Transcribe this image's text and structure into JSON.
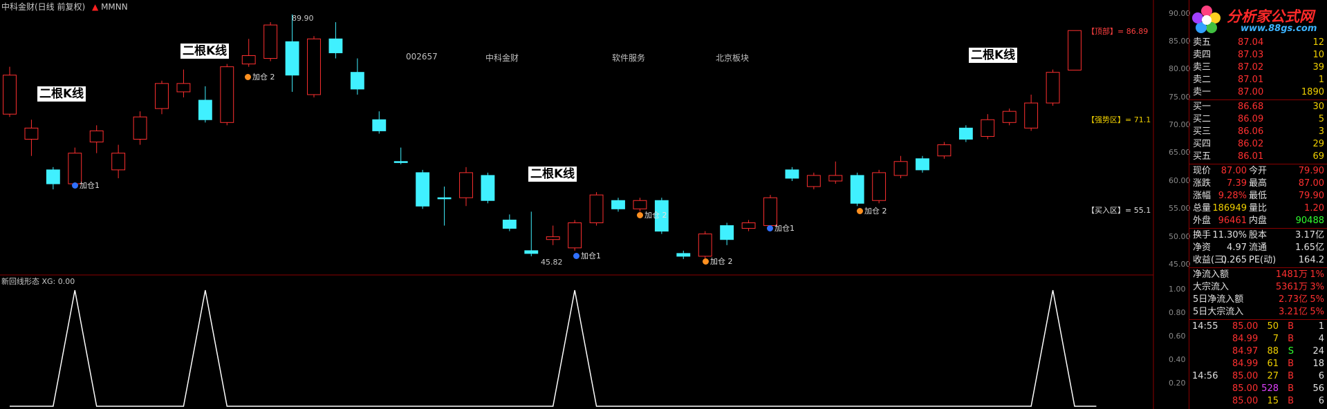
{
  "header": {
    "title": "中科金财(日线 前复权)",
    "indicator": "MMNN",
    "arrow_icon": "up-arrow-icon"
  },
  "info_bar": {
    "code": "002657",
    "name": "中科金财",
    "industry": "软件服务",
    "board": "北京板块",
    "code_color": "#f0d000",
    "name_color": "#ff3030",
    "industry_color": "#40d0ff",
    "board_color": "#e0e0e0"
  },
  "callouts": [
    "二根K线",
    "二根K线",
    "二根K线",
    "二根K线"
  ],
  "add_labels": [
    "加仓1",
    "加仓 2",
    "加仓1",
    "加仓 2",
    "加仓 2",
    "加仓1",
    "加仓 2"
  ],
  "high_label": "89.90",
  "low_label": "45.82",
  "zones": {
    "top": "【顶部】= 86.89",
    "strong": "【强势区】= 71.1",
    "buy": "【买入区】= 55.1"
  },
  "price_axis": [
    "90.00",
    "85.00",
    "80.00",
    "75.00",
    "70.00",
    "65.00",
    "60.00",
    "55.00",
    "50.00",
    "45.00"
  ],
  "indicator_panel": {
    "label": "新回线形态 XG: 0.00",
    "axis": [
      "1.00",
      "0.80",
      "0.60",
      "0.40",
      "0.20"
    ]
  },
  "logo": {
    "text": "分析家公式网",
    "url": "www.88gs.com",
    "icon": "flower-logo-icon"
  },
  "order_book": {
    "asks": [
      {
        "label": "卖五",
        "price": "87.04",
        "vol": "12"
      },
      {
        "label": "卖四",
        "price": "87.03",
        "vol": "10"
      },
      {
        "label": "卖三",
        "price": "87.02",
        "vol": "39"
      },
      {
        "label": "卖二",
        "price": "87.01",
        "vol": "1"
      },
      {
        "label": "卖一",
        "price": "87.00",
        "vol": "1890"
      }
    ],
    "bids": [
      {
        "label": "买一",
        "price": "86.68",
        "vol": "30"
      },
      {
        "label": "买二",
        "price": "86.09",
        "vol": "5"
      },
      {
        "label": "买三",
        "price": "86.06",
        "vol": "3"
      },
      {
        "label": "买四",
        "price": "86.02",
        "vol": "29"
      },
      {
        "label": "买五",
        "price": "86.01",
        "vol": "69"
      }
    ]
  },
  "stats": [
    {
      "l1": "现价",
      "v1": "87.00",
      "l2": "今开",
      "v2": "79.90",
      "c1": "#ff3030",
      "c2": "#ff3030"
    },
    {
      "l1": "涨跌",
      "v1": "7.39",
      "l2": "最高",
      "v2": "87.00",
      "c1": "#ff3030",
      "c2": "#ff3030"
    },
    {
      "l1": "涨幅",
      "v1": "9.28%",
      "l2": "最低",
      "v2": "79.90",
      "c1": "#ff3030",
      "c2": "#ff3030"
    },
    {
      "l1": "总量",
      "v1": "186949",
      "l2": "量比",
      "v2": "1.20",
      "c1": "#f0d000",
      "c2": "#ff3030"
    },
    {
      "l1": "外盘",
      "v1": "96461",
      "l2": "内盘",
      "v2": "90488",
      "c1": "#ff3030",
      "c2": "#30ff30"
    },
    {
      "l1": "换手",
      "v1": "11.30%",
      "l2": "股本",
      "v2": "3.17亿",
      "c1": "#e0e0e0",
      "c2": "#e0e0e0"
    },
    {
      "l1": "净资",
      "v1": "4.97",
      "l2": "流通",
      "v2": "1.65亿",
      "c1": "#e0e0e0",
      "c2": "#e0e0e0"
    },
    {
      "l1": "收益(三)",
      "v1": "0.265",
      "l2": "PE(动)",
      "v2": "164.2",
      "c1": "#e0e0e0",
      "c2": "#e0e0e0"
    }
  ],
  "flows": [
    {
      "label": "净流入额",
      "value": "1481万",
      "pct": "1%"
    },
    {
      "label": "大宗流入",
      "value": "5361万",
      "pct": "3%"
    },
    {
      "label": "5日净流入额",
      "value": "2.73亿",
      "pct": "5%"
    },
    {
      "label": "5日大宗流入",
      "value": "3.21亿",
      "pct": "5%"
    }
  ],
  "ticks": [
    {
      "time": "14:55",
      "price": "85.00",
      "vol": "50",
      "side": "B",
      "n": "1",
      "vc": "#f0d000"
    },
    {
      "time": "",
      "price": "84.99",
      "vol": "7",
      "side": "B",
      "n": "4",
      "vc": "#f0d000"
    },
    {
      "time": "",
      "price": "84.97",
      "vol": "88",
      "side": "S",
      "n": "24",
      "vc": "#f0d000"
    },
    {
      "time": "",
      "price": "84.99",
      "vol": "61",
      "side": "B",
      "n": "18",
      "vc": "#f0d000"
    },
    {
      "time": "14:56",
      "price": "85.00",
      "vol": "27",
      "side": "B",
      "n": "6",
      "vc": "#f0d000"
    },
    {
      "time": "",
      "price": "85.00",
      "vol": "528",
      "side": "B",
      "n": "56",
      "vc": "#e040ff"
    },
    {
      "time": "",
      "price": "85.00",
      "vol": "15",
      "side": "B",
      "n": "6",
      "vc": "#f0d000"
    }
  ],
  "chart_data": {
    "type": "candlestick",
    "ylim": [
      45,
      90
    ],
    "candles": [
      {
        "o": 72.0,
        "c": 79.0,
        "h": 80.5,
        "l": 71.5
      },
      {
        "o": 67.5,
        "c": 69.5,
        "h": 71.0,
        "l": 64.5
      },
      {
        "o": 62.0,
        "c": 59.5,
        "h": 62.5,
        "l": 58.5
      },
      {
        "o": 59.5,
        "c": 65.0,
        "h": 66.0,
        "l": 59.0
      },
      {
        "o": 67.0,
        "c": 69.0,
        "h": 70.0,
        "l": 65.0
      },
      {
        "o": 62.0,
        "c": 65.0,
        "h": 66.5,
        "l": 60.5
      },
      {
        "o": 67.5,
        "c": 71.5,
        "h": 72.5,
        "l": 66.5
      },
      {
        "o": 73.0,
        "c": 77.5,
        "h": 78.0,
        "l": 72.0
      },
      {
        "o": 76.0,
        "c": 77.5,
        "h": 80.0,
        "l": 75.0
      },
      {
        "o": 74.5,
        "c": 71.0,
        "h": 77.0,
        "l": 70.5
      },
      {
        "o": 70.5,
        "c": 80.5,
        "h": 81.0,
        "l": 70.0
      },
      {
        "o": 81.0,
        "c": 82.5,
        "h": 85.5,
        "l": 80.5
      },
      {
        "o": 82.0,
        "c": 88.0,
        "h": 88.5,
        "l": 81.5
      },
      {
        "o": 85.0,
        "c": 79.0,
        "h": 89.9,
        "l": 76.0
      },
      {
        "o": 75.5,
        "c": 85.5,
        "h": 86.0,
        "l": 75.0
      },
      {
        "o": 85.5,
        "c": 83.0,
        "h": 88.5,
        "l": 82.0
      },
      {
        "o": 79.5,
        "c": 76.5,
        "h": 82.0,
        "l": 75.5
      },
      {
        "o": 71.0,
        "c": 69.0,
        "h": 72.5,
        "l": 68.5
      },
      {
        "o": 63.5,
        "c": 63.3,
        "h": 66.0,
        "l": 63.0
      },
      {
        "o": 61.5,
        "c": 55.5,
        "h": 62.0,
        "l": 55.0
      },
      {
        "o": 57.0,
        "c": 56.8,
        "h": 59.0,
        "l": 52.0
      },
      {
        "o": 57.0,
        "c": 61.5,
        "h": 62.5,
        "l": 55.5
      },
      {
        "o": 61.0,
        "c": 56.5,
        "h": 61.5,
        "l": 56.0
      },
      {
        "o": 53.0,
        "c": 51.5,
        "h": 54.0,
        "l": 51.0
      },
      {
        "o": 47.5,
        "c": 47.0,
        "h": 54.5,
        "l": 46.5
      },
      {
        "o": 49.5,
        "c": 50.0,
        "h": 52.0,
        "l": 48.5
      },
      {
        "o": 48.0,
        "c": 52.5,
        "h": 53.0,
        "l": 47.5
      },
      {
        "o": 52.5,
        "c": 57.5,
        "h": 58.0,
        "l": 52.0
      },
      {
        "o": 56.5,
        "c": 55.0,
        "h": 57.0,
        "l": 54.5
      },
      {
        "o": 55.0,
        "c": 56.5,
        "h": 57.0,
        "l": 54.5
      },
      {
        "o": 56.5,
        "c": 51.0,
        "h": 57.0,
        "l": 50.5
      },
      {
        "o": 47.0,
        "c": 46.5,
        "h": 47.5,
        "l": 46.0
      },
      {
        "o": 46.5,
        "c": 50.5,
        "h": 51.0,
        "l": 46.0
      },
      {
        "o": 52.0,
        "c": 49.5,
        "h": 52.5,
        "l": 48.5
      },
      {
        "o": 51.5,
        "c": 52.5,
        "h": 53.0,
        "l": 51.0
      },
      {
        "o": 52.0,
        "c": 57.0,
        "h": 57.5,
        "l": 51.5
      },
      {
        "o": 62.0,
        "c": 60.5,
        "h": 62.5,
        "l": 60.0
      },
      {
        "o": 59.0,
        "c": 61.0,
        "h": 61.5,
        "l": 58.5
      },
      {
        "o": 60.0,
        "c": 61.0,
        "h": 63.5,
        "l": 59.5
      },
      {
        "o": 61.0,
        "c": 56.0,
        "h": 61.5,
        "l": 55.5
      },
      {
        "o": 56.5,
        "c": 61.5,
        "h": 62.0,
        "l": 56.0
      },
      {
        "o": 61.0,
        "c": 63.5,
        "h": 64.5,
        "l": 60.5
      },
      {
        "o": 64.0,
        "c": 62.0,
        "h": 64.5,
        "l": 61.5
      },
      {
        "o": 64.5,
        "c": 66.5,
        "h": 67.0,
        "l": 64.0
      },
      {
        "o": 69.5,
        "c": 67.5,
        "h": 70.0,
        "l": 67.0
      },
      {
        "o": 68.0,
        "c": 71.0,
        "h": 72.0,
        "l": 67.5
      },
      {
        "o": 70.5,
        "c": 72.5,
        "h": 73.0,
        "l": 70.0
      },
      {
        "o": 69.5,
        "c": 74.0,
        "h": 75.5,
        "l": 69.0
      },
      {
        "o": 74.0,
        "c": 79.5,
        "h": 80.0,
        "l": 73.5
      },
      {
        "o": 79.9,
        "c": 87.0,
        "h": 87.0,
        "l": 79.9
      }
    ],
    "indicator": {
      "ylim": [
        0,
        1
      ],
      "values": [
        0,
        0,
        0,
        1,
        0,
        0,
        0,
        0,
        0,
        1,
        0,
        0,
        0,
        0,
        0,
        0,
        0,
        0,
        0,
        0,
        0,
        0,
        0,
        0,
        0,
        0,
        1,
        0,
        0,
        0,
        0,
        0,
        0,
        0,
        0,
        0,
        0,
        0,
        0,
        0,
        0,
        0,
        0,
        0,
        0,
        0,
        0,
        0,
        1,
        0,
        0
      ]
    }
  }
}
